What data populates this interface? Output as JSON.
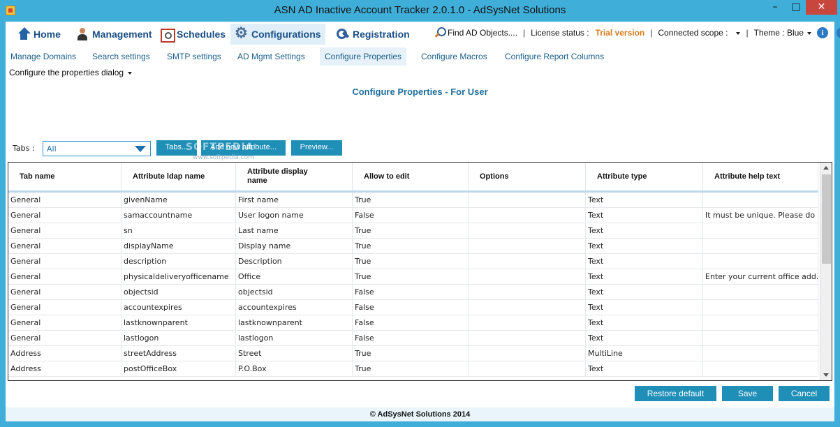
{
  "window": {
    "title": "ASN AD Inactive Account Tracker 2.0.1.0 - AdSysNet Solutions",
    "minimize": "–",
    "maximize": "□",
    "close": "✕"
  },
  "main_menu": [
    {
      "label": "Home",
      "icon": "home-icon"
    },
    {
      "label": "Management",
      "icon": "person-icon"
    },
    {
      "label": "Schedules",
      "icon": "calendar-icon"
    },
    {
      "label": "Configurations",
      "icon": "gear-icon"
    },
    {
      "label": "Registration",
      "icon": "key-icon"
    }
  ],
  "status": {
    "find_label": "Find AD Objects....",
    "license_label": "License status :",
    "license_value": "Trial version",
    "scope_label": "Connected scope :",
    "theme_label": "Theme : Blue",
    "info_glyph": "i",
    "help_glyph": "?",
    "separator": "|"
  },
  "sub_menu": [
    "Manage Domains",
    "Search settings",
    "SMTP settings",
    "AD Mgmt Settings",
    "Configure Properties",
    "Configure Macros",
    "Configure Report Columns"
  ],
  "dialog_select": "Configure the properties dialog",
  "page_title": "Configure Properties - For User",
  "tabs_filter": {
    "label": "Tabs :",
    "value": "All"
  },
  "buttons": {
    "tabs": "Tabs...",
    "add_attribute": "Add new attribute...",
    "preview": "Preview...",
    "restore_default": "Restore default",
    "save": "Save",
    "cancel": "Cancel"
  },
  "watermark": {
    "text": "SOFTPEDIA",
    "url": "www.softpedia.com"
  },
  "table": {
    "columns": [
      "Tab name",
      "Attribute ldap name",
      "Attribute display name",
      "Allow to edit",
      "Options",
      "Attribute type",
      "Attribute help text"
    ],
    "rows": [
      [
        "General",
        "givenName",
        "First name",
        "True",
        "",
        "Text",
        ""
      ],
      [
        "General",
        "samaccountname",
        "User logon name",
        "False",
        "",
        "Text",
        "It must be unique. Please do ..."
      ],
      [
        "General",
        "sn",
        "Last name",
        "True",
        "",
        "Text",
        ""
      ],
      [
        "General",
        "displayName",
        "Display name",
        "True",
        "",
        "Text",
        ""
      ],
      [
        "General",
        "description",
        "Description",
        "True",
        "",
        "Text",
        ""
      ],
      [
        "General",
        "physicaldeliveryofficename",
        "Office",
        "True",
        "",
        "Text",
        "Enter your current office add..."
      ],
      [
        "General",
        "objectsid",
        "objectsid",
        "False",
        "",
        "Text",
        ""
      ],
      [
        "General",
        "accountexpires",
        "accountexpires",
        "False",
        "",
        "Text",
        ""
      ],
      [
        "General",
        "lastknownparent",
        "lastknownparent",
        "False",
        "",
        "Text",
        ""
      ],
      [
        "General",
        "lastlogon",
        "lastlogon",
        "False",
        "",
        "Text",
        ""
      ],
      [
        "Address",
        "streetAddress",
        "Street",
        "True",
        "",
        "MultiLine",
        ""
      ],
      [
        "Address",
        "postOfficeBox",
        "P.O.Box",
        "True",
        "",
        "Text",
        ""
      ]
    ]
  },
  "footer": "© AdSysNet Solutions 2014",
  "colors": {
    "frame": "#3faed9",
    "accent_button": "#1f8fb8",
    "menu_text": "#1a4f86",
    "trial": "#d07a1a"
  }
}
